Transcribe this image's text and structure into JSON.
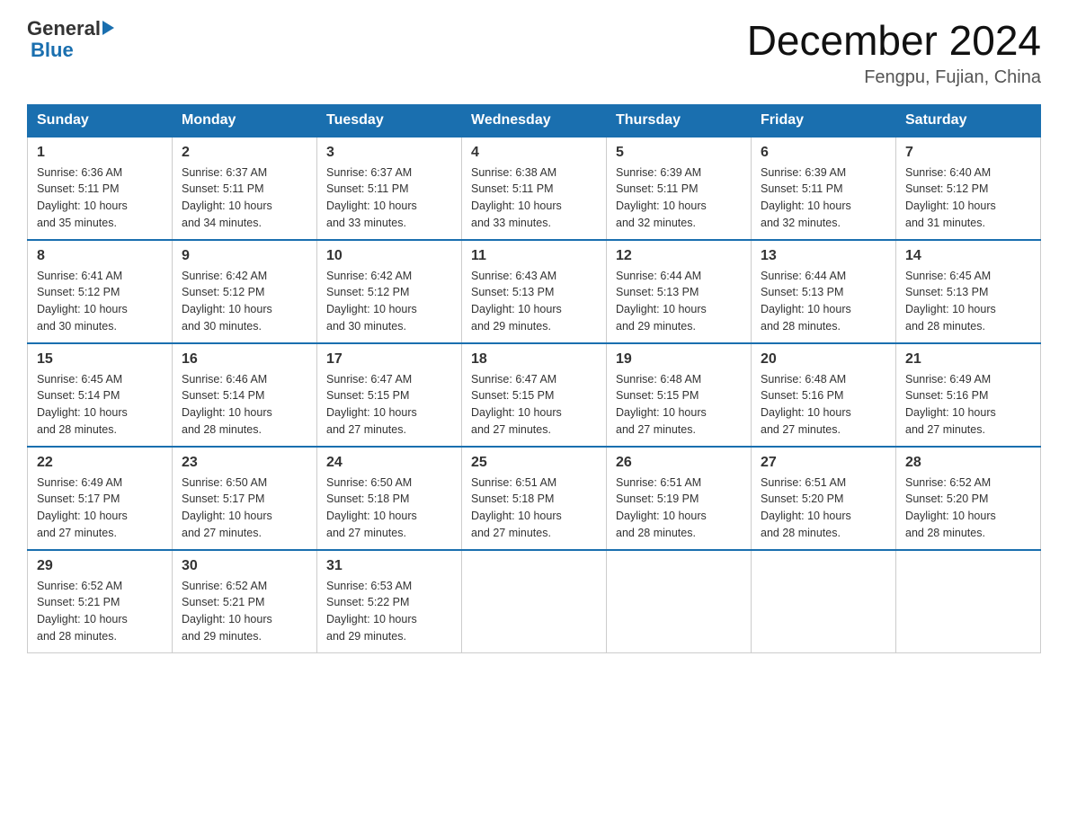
{
  "header": {
    "logo_general": "General",
    "logo_blue": "Blue",
    "title": "December 2024",
    "subtitle": "Fengpu, Fujian, China"
  },
  "columns": [
    "Sunday",
    "Monday",
    "Tuesday",
    "Wednesday",
    "Thursday",
    "Friday",
    "Saturday"
  ],
  "weeks": [
    [
      {
        "day": "1",
        "sunrise": "6:36 AM",
        "sunset": "5:11 PM",
        "daylight": "10 hours and 35 minutes."
      },
      {
        "day": "2",
        "sunrise": "6:37 AM",
        "sunset": "5:11 PM",
        "daylight": "10 hours and 34 minutes."
      },
      {
        "day": "3",
        "sunrise": "6:37 AM",
        "sunset": "5:11 PM",
        "daylight": "10 hours and 33 minutes."
      },
      {
        "day": "4",
        "sunrise": "6:38 AM",
        "sunset": "5:11 PM",
        "daylight": "10 hours and 33 minutes."
      },
      {
        "day": "5",
        "sunrise": "6:39 AM",
        "sunset": "5:11 PM",
        "daylight": "10 hours and 32 minutes."
      },
      {
        "day": "6",
        "sunrise": "6:39 AM",
        "sunset": "5:11 PM",
        "daylight": "10 hours and 32 minutes."
      },
      {
        "day": "7",
        "sunrise": "6:40 AM",
        "sunset": "5:12 PM",
        "daylight": "10 hours and 31 minutes."
      }
    ],
    [
      {
        "day": "8",
        "sunrise": "6:41 AM",
        "sunset": "5:12 PM",
        "daylight": "10 hours and 30 minutes."
      },
      {
        "day": "9",
        "sunrise": "6:42 AM",
        "sunset": "5:12 PM",
        "daylight": "10 hours and 30 minutes."
      },
      {
        "day": "10",
        "sunrise": "6:42 AM",
        "sunset": "5:12 PM",
        "daylight": "10 hours and 30 minutes."
      },
      {
        "day": "11",
        "sunrise": "6:43 AM",
        "sunset": "5:13 PM",
        "daylight": "10 hours and 29 minutes."
      },
      {
        "day": "12",
        "sunrise": "6:44 AM",
        "sunset": "5:13 PM",
        "daylight": "10 hours and 29 minutes."
      },
      {
        "day": "13",
        "sunrise": "6:44 AM",
        "sunset": "5:13 PM",
        "daylight": "10 hours and 28 minutes."
      },
      {
        "day": "14",
        "sunrise": "6:45 AM",
        "sunset": "5:13 PM",
        "daylight": "10 hours and 28 minutes."
      }
    ],
    [
      {
        "day": "15",
        "sunrise": "6:45 AM",
        "sunset": "5:14 PM",
        "daylight": "10 hours and 28 minutes."
      },
      {
        "day": "16",
        "sunrise": "6:46 AM",
        "sunset": "5:14 PM",
        "daylight": "10 hours and 28 minutes."
      },
      {
        "day": "17",
        "sunrise": "6:47 AM",
        "sunset": "5:15 PM",
        "daylight": "10 hours and 27 minutes."
      },
      {
        "day": "18",
        "sunrise": "6:47 AM",
        "sunset": "5:15 PM",
        "daylight": "10 hours and 27 minutes."
      },
      {
        "day": "19",
        "sunrise": "6:48 AM",
        "sunset": "5:15 PM",
        "daylight": "10 hours and 27 minutes."
      },
      {
        "day": "20",
        "sunrise": "6:48 AM",
        "sunset": "5:16 PM",
        "daylight": "10 hours and 27 minutes."
      },
      {
        "day": "21",
        "sunrise": "6:49 AM",
        "sunset": "5:16 PM",
        "daylight": "10 hours and 27 minutes."
      }
    ],
    [
      {
        "day": "22",
        "sunrise": "6:49 AM",
        "sunset": "5:17 PM",
        "daylight": "10 hours and 27 minutes."
      },
      {
        "day": "23",
        "sunrise": "6:50 AM",
        "sunset": "5:17 PM",
        "daylight": "10 hours and 27 minutes."
      },
      {
        "day": "24",
        "sunrise": "6:50 AM",
        "sunset": "5:18 PM",
        "daylight": "10 hours and 27 minutes."
      },
      {
        "day": "25",
        "sunrise": "6:51 AM",
        "sunset": "5:18 PM",
        "daylight": "10 hours and 27 minutes."
      },
      {
        "day": "26",
        "sunrise": "6:51 AM",
        "sunset": "5:19 PM",
        "daylight": "10 hours and 28 minutes."
      },
      {
        "day": "27",
        "sunrise": "6:51 AM",
        "sunset": "5:20 PM",
        "daylight": "10 hours and 28 minutes."
      },
      {
        "day": "28",
        "sunrise": "6:52 AM",
        "sunset": "5:20 PM",
        "daylight": "10 hours and 28 minutes."
      }
    ],
    [
      {
        "day": "29",
        "sunrise": "6:52 AM",
        "sunset": "5:21 PM",
        "daylight": "10 hours and 28 minutes."
      },
      {
        "day": "30",
        "sunrise": "6:52 AM",
        "sunset": "5:21 PM",
        "daylight": "10 hours and 29 minutes."
      },
      {
        "day": "31",
        "sunrise": "6:53 AM",
        "sunset": "5:22 PM",
        "daylight": "10 hours and 29 minutes."
      },
      null,
      null,
      null,
      null
    ]
  ],
  "labels": {
    "sunrise": "Sunrise:",
    "sunset": "Sunset:",
    "daylight": "Daylight:"
  }
}
